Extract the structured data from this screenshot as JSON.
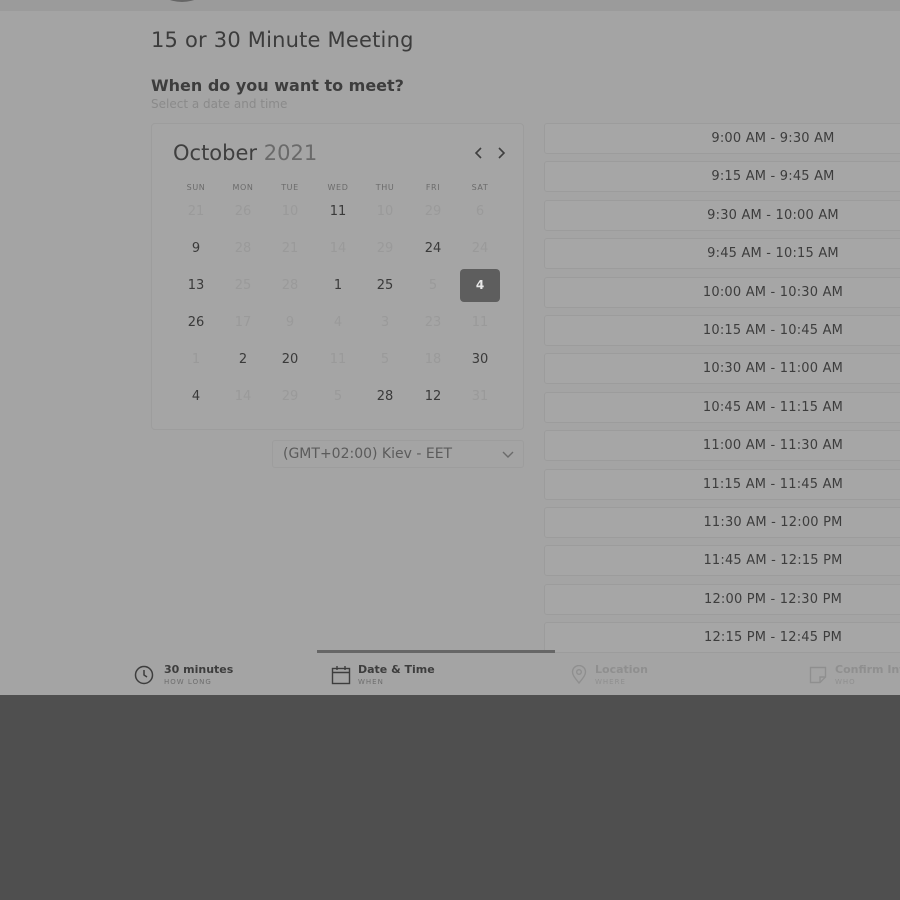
{
  "meeting": {
    "title": "15 or 30 Minute Meeting",
    "question": "When do you want to meet?",
    "question_sub": "Select a date and time"
  },
  "calendar": {
    "month": "October",
    "year": "2021",
    "prev_icon": "chevron-left-icon",
    "next_icon": "chevron-right-icon",
    "weekdays": [
      "SUN",
      "MON",
      "TUE",
      "WED",
      "THU",
      "FRI",
      "SAT"
    ],
    "rows": [
      [
        {
          "d": "21",
          "s": "muted"
        },
        {
          "d": "26",
          "s": "muted"
        },
        {
          "d": "10",
          "s": "muted"
        },
        {
          "d": "11",
          "s": "active"
        },
        {
          "d": "10",
          "s": "muted"
        },
        {
          "d": "29",
          "s": "muted"
        },
        {
          "d": "6",
          "s": "muted"
        }
      ],
      [
        {
          "d": "9",
          "s": "active"
        },
        {
          "d": "28",
          "s": "muted"
        },
        {
          "d": "21",
          "s": "muted"
        },
        {
          "d": "14",
          "s": "muted"
        },
        {
          "d": "29",
          "s": "muted"
        },
        {
          "d": "24",
          "s": "active"
        },
        {
          "d": "24",
          "s": "muted"
        }
      ],
      [
        {
          "d": "13",
          "s": "active"
        },
        {
          "d": "25",
          "s": "muted"
        },
        {
          "d": "28",
          "s": "muted"
        },
        {
          "d": "1",
          "s": "active"
        },
        {
          "d": "25",
          "s": "active"
        },
        {
          "d": "5",
          "s": "muted"
        },
        {
          "d": "4",
          "s": "selected"
        }
      ],
      [
        {
          "d": "26",
          "s": "active"
        },
        {
          "d": "17",
          "s": "muted"
        },
        {
          "d": "9",
          "s": "muted"
        },
        {
          "d": "4",
          "s": "muted"
        },
        {
          "d": "3",
          "s": "muted"
        },
        {
          "d": "23",
          "s": "muted"
        },
        {
          "d": "11",
          "s": "muted"
        }
      ],
      [
        {
          "d": "1",
          "s": "muted"
        },
        {
          "d": "2",
          "s": "active"
        },
        {
          "d": "20",
          "s": "active"
        },
        {
          "d": "11",
          "s": "muted"
        },
        {
          "d": "5",
          "s": "muted"
        },
        {
          "d": "18",
          "s": "muted"
        },
        {
          "d": "30",
          "s": "active"
        }
      ],
      [
        {
          "d": "4",
          "s": "active"
        },
        {
          "d": "14",
          "s": "muted"
        },
        {
          "d": "29",
          "s": "muted"
        },
        {
          "d": "5",
          "s": "muted"
        },
        {
          "d": "28",
          "s": "active"
        },
        {
          "d": "12",
          "s": "active"
        },
        {
          "d": "31",
          "s": "muted"
        }
      ]
    ]
  },
  "timezone": {
    "value": "(GMT+02:00) Kiev - EET",
    "icon": "chevron-down-icon"
  },
  "time_slots": [
    "9:00 AM - 9:30 AM",
    "9:15 AM - 9:45 AM",
    "9:30 AM - 10:00 AM",
    "9:45 AM - 10:15 AM",
    "10:00 AM - 10:30 AM",
    "10:15 AM - 10:45 AM",
    "10:30 AM - 11:00 AM",
    "10:45 AM - 11:15 AM",
    "11:00 AM - 11:30 AM",
    "11:15 AM - 11:45 AM",
    "11:30 AM - 12:00 PM",
    "11:45 AM - 12:15 PM",
    "12:00 PM - 12:30 PM",
    "12:15 PM - 12:45 PM"
  ],
  "steps": [
    {
      "title": "30 minutes",
      "sub": "HOW LONG",
      "icon": "clock-icon",
      "state": "done"
    },
    {
      "title": "Date & Time",
      "sub": "WHEN",
      "icon": "calendar-icon",
      "state": "current"
    },
    {
      "title": "Location",
      "sub": "WHERE",
      "icon": "location-pin-icon",
      "state": "pending"
    },
    {
      "title": "Confirm Info",
      "sub": "WHO",
      "icon": "note-icon",
      "state": "pending"
    }
  ],
  "colors": {
    "page_overlay": "#a4a4a4",
    "bottom_backdrop": "#4f4f4f",
    "selected_day": "#5e5e5e",
    "progress_bar": "#666666"
  }
}
